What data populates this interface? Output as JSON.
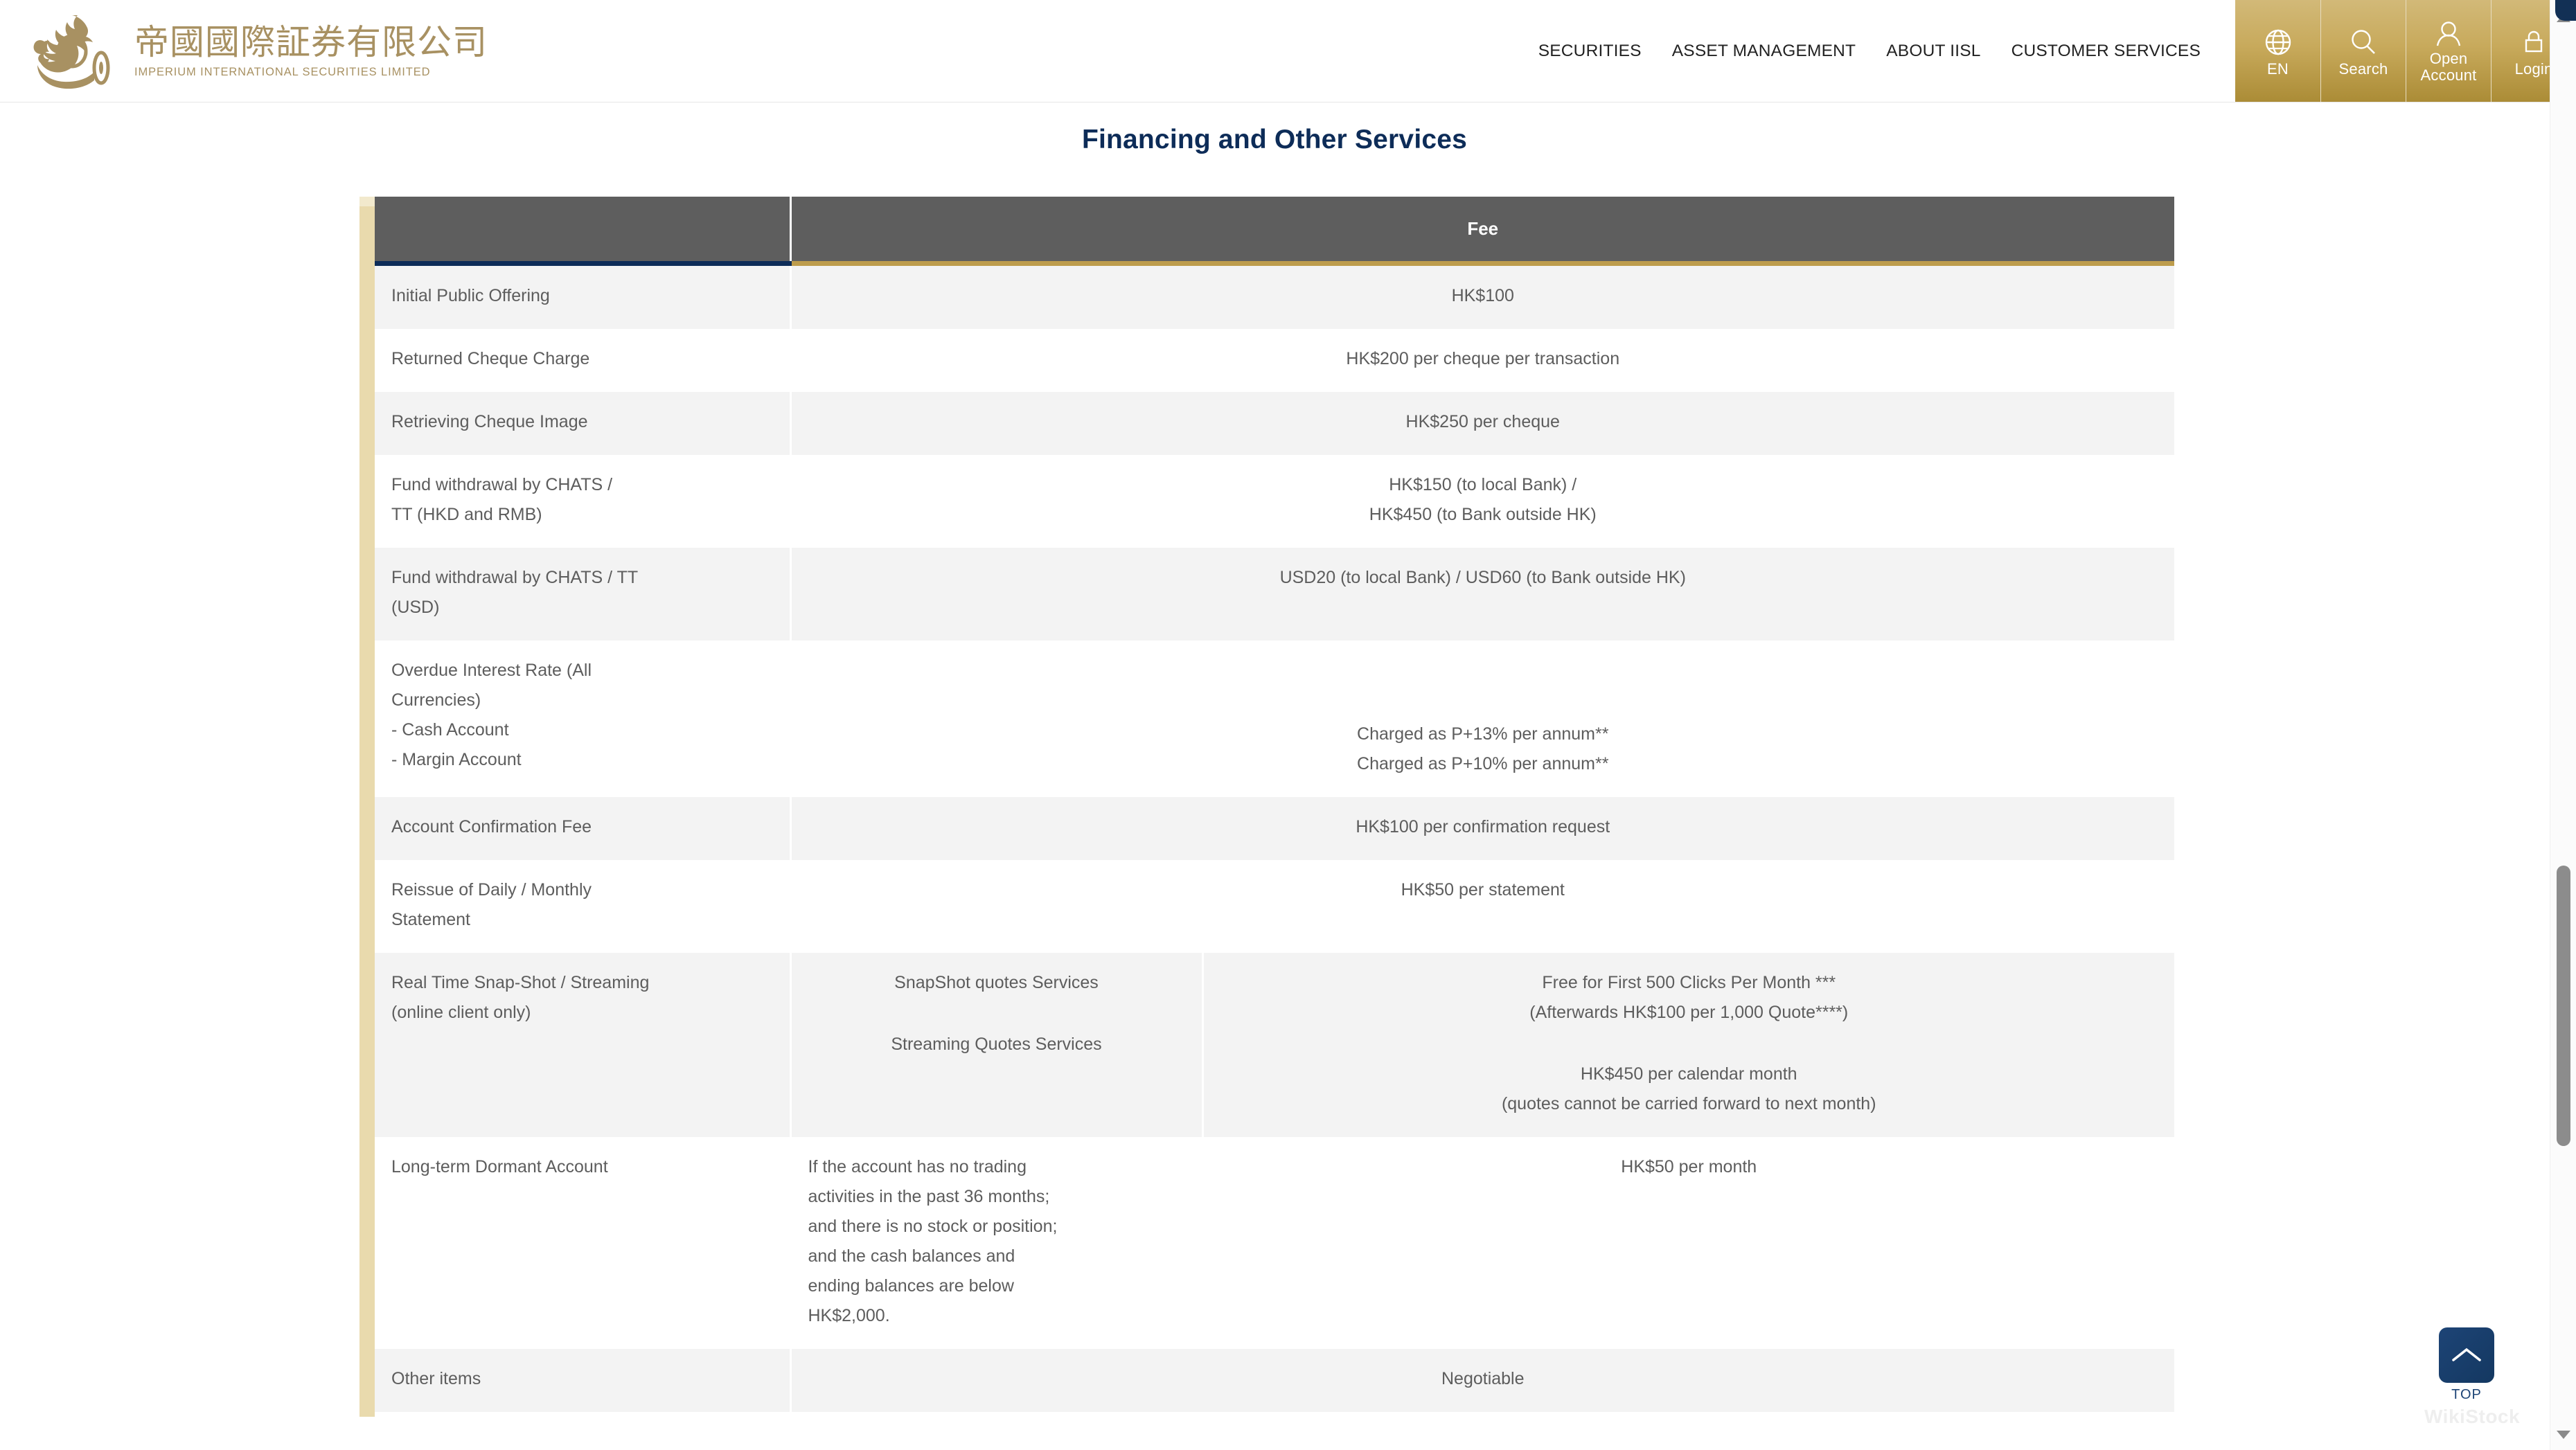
{
  "header": {
    "logo": {
      "cn": "帝國國際証券有限公司",
      "en": "IMPERIUM INTERNATIONAL SECURITIES LIMITED",
      "icon": "phoenix-logo-icon",
      "color": "#a89162"
    },
    "nav": [
      {
        "label": "SECURITIES"
      },
      {
        "label": "ASSET MANAGEMENT"
      },
      {
        "label": "ABOUT IISL"
      },
      {
        "label": "CUSTOMER SERVICES"
      }
    ],
    "utilities": [
      {
        "label": "EN",
        "icon": "globe-icon"
      },
      {
        "label": "Search",
        "icon": "search-icon"
      },
      {
        "label": "Open\nAccount",
        "label_line1": "Open",
        "label_line2": "Account",
        "icon": "user-icon"
      },
      {
        "label": "Login",
        "icon": "lock-icon"
      }
    ],
    "accent_gold": "#c8aa5c"
  },
  "page": {
    "title": "Financing and Other Services",
    "title_color": "#0d2c58"
  },
  "table": {
    "header": {
      "col1": "",
      "fee": "Fee"
    },
    "colors": {
      "header_bg": "#5e5e5e",
      "underline_left": "#0d2c58",
      "underline_fee": "#bd9c4c",
      "rail": "#e9daad",
      "shade_row": "#f3f3f3",
      "text": "#5d5d5d"
    },
    "rows": [
      {
        "shade": true,
        "label": [
          "Initial Public Offering"
        ],
        "mid": [],
        "fee": [
          "HK$100"
        ]
      },
      {
        "shade": false,
        "label": [
          "Returned Cheque Charge"
        ],
        "mid": [],
        "fee": [
          "HK$200 per cheque per transaction"
        ]
      },
      {
        "shade": true,
        "label": [
          "Retrieving Cheque Image"
        ],
        "mid": [],
        "fee": [
          "HK$250 per cheque"
        ]
      },
      {
        "shade": false,
        "label": [
          "Fund withdrawal by CHATS /",
          "TT (HKD and RMB)"
        ],
        "mid": [],
        "fee": [
          "HK$150 (to local Bank) /",
          "HK$450 (to Bank outside HK)"
        ]
      },
      {
        "shade": true,
        "label": [
          "Fund withdrawal by CHATS / TT",
          "(USD)"
        ],
        "mid": [],
        "fee": [
          "USD20 (to local Bank) / USD60 (to Bank outside HK)"
        ]
      },
      {
        "shade": false,
        "label": [
          "Overdue Interest Rate (All",
          "Currencies)",
          "- Cash Account",
          "- Margin Account"
        ],
        "mid": [],
        "fee": [
          "",
          "",
          "Charged as P+13% per annum**",
          "Charged as P+10% per annum**"
        ]
      },
      {
        "shade": true,
        "label": [
          "Account Confirmation Fee"
        ],
        "mid": [],
        "fee": [
          "HK$100 per confirmation request"
        ]
      },
      {
        "shade": false,
        "label": [
          "Reissue of Daily / Monthly",
          "Statement"
        ],
        "mid": [],
        "fee": [
          "HK$50 per statement"
        ]
      },
      {
        "shade": true,
        "label": [
          "Real Time Snap-Shot / Streaming",
          "(online client only)"
        ],
        "mid": [
          "SnapShot quotes Services",
          "",
          "Streaming Quotes Services"
        ],
        "fee": [
          "Free for First 500 Clicks Per Month ***",
          "(Afterwards HK$100 per 1,000 Quote****)",
          "",
          "HK$450 per calendar month",
          "(quotes cannot be carried forward to next month)"
        ]
      },
      {
        "shade": false,
        "label": [
          "Long-term Dormant Account"
        ],
        "mid": [
          "If the account has no trading",
          "activities in the past 36 months;",
          "and there is no stock or position;",
          "and the cash balances and",
          "ending balances are below",
          "HK$2,000."
        ],
        "mid_align": "left",
        "fee": [
          "HK$50 per month"
        ]
      },
      {
        "shade": true,
        "label": [
          "Other items"
        ],
        "mid": [],
        "fee": [
          "Negotiable"
        ]
      }
    ]
  },
  "back_to_top": {
    "label": "TOP",
    "icon": "chevron-up-icon",
    "color": "#1d4476"
  },
  "watermark": {
    "text": "WikiStock"
  },
  "scrollbar": {
    "up_icon": "triangle-up-icon",
    "down_icon": "triangle-down-icon",
    "thumb": "scrollbar-thumb"
  }
}
